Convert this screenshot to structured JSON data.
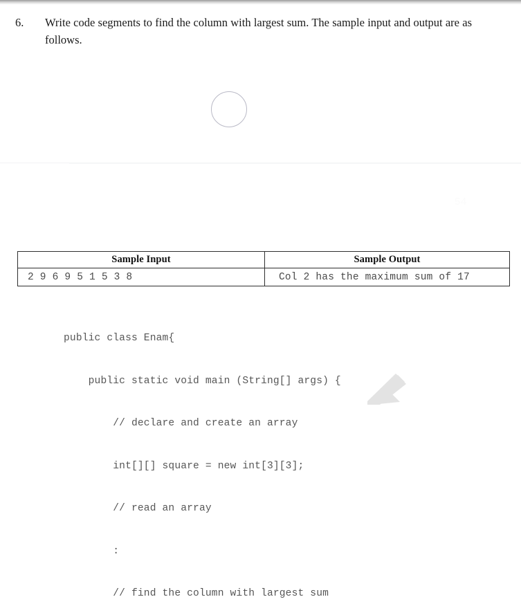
{
  "document": {
    "page_number_watermark": "54",
    "question": {
      "number": "6.",
      "text": "Write code segments to find the column with largest sum. The sample input and output are as follows."
    },
    "placeholder_circle": {
      "icon": "circle-outline-icon",
      "border_color": "#b9b9c6"
    },
    "table": {
      "headers": [
        "Sample Input",
        "Sample Output"
      ],
      "rows": [
        {
          "input": "2 9 6 9 5 1 5 3 8",
          "output": "Col 2 has the maximum sum of 17"
        }
      ],
      "border_color": "#2e2e2e"
    },
    "code": {
      "language": "java",
      "lines": [
        "public class Enam{",
        "    public static void main (String[] args) {",
        "        // declare and create an array",
        "        int[][] square = new int[3][3];",
        "        // read an array",
        "        :",
        "        // find the column with largest sum"
      ],
      "text_color": "#565656"
    },
    "decorations": {
      "corner_arrow_icon": "arrow-up-left-icon",
      "corner_arrow_color": "#e3e3e3",
      "top_shadow": true,
      "page_separator": true
    }
  }
}
